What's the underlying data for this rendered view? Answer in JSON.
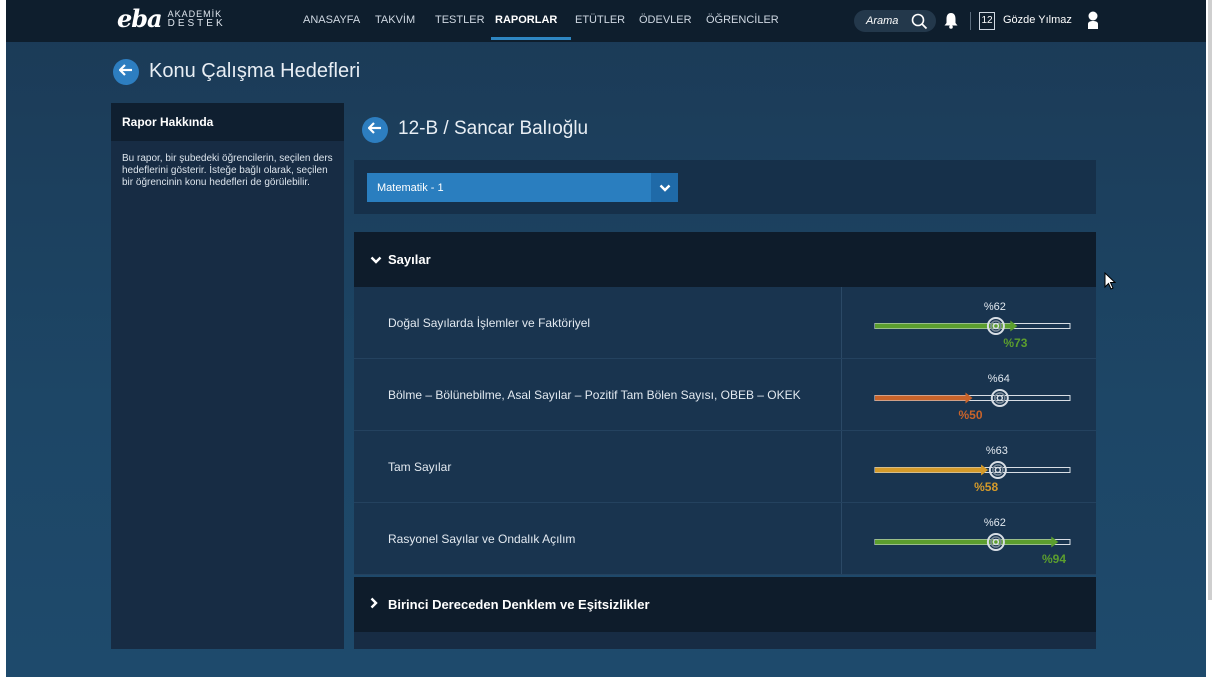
{
  "brand": {
    "logo": "eba",
    "line1": "AKADEMİK",
    "line2": "DESTEK"
  },
  "nav": {
    "items": [
      {
        "label": "ANASAYFA"
      },
      {
        "label": "TAKVİM"
      },
      {
        "label": "TESTLER"
      },
      {
        "label": "RAPORLAR",
        "active": true
      },
      {
        "label": "ETÜTLER"
      },
      {
        "label": "ÖDEVLER"
      },
      {
        "label": "ÖĞRENCİLER"
      }
    ]
  },
  "search": {
    "placeholder": "Arama"
  },
  "messages": {
    "count": "12"
  },
  "user": {
    "name": "Gözde Yılmaz"
  },
  "page": {
    "title": "Konu Çalışma Hedefleri"
  },
  "sidebar": {
    "heading": "Rapor Hakkında",
    "text": "Bu rapor, bir şubedeki öğrencilerin, seçilen ders hedeflerini gösterir. İsteğe bağlı olarak, seçilen bir öğrencinin konu hedefleri de görülebilir."
  },
  "main": {
    "subtitle": "12-B / Sancar Balıoğlu",
    "select": {
      "value": "Matematik - 1"
    },
    "sections": [
      {
        "title": "Sayılar",
        "expanded": true,
        "topics": [
          {
            "name": "Doğal Sayılarda İşlemler ve Faktöriyel",
            "target_label": "%62",
            "target": 62,
            "actual_label": "%73",
            "actual": 73,
            "color": "#5c9e2e"
          },
          {
            "name": "Bölme – Bölünebilme, Asal Sayılar – Pozitif Tam Bölen Sayısı, OBEB – OKEK",
            "target_label": "%64",
            "target": 64,
            "actual_label": "%50",
            "actual": 50,
            "color": "#c8632a"
          },
          {
            "name": "Tam Sayılar",
            "target_label": "%63",
            "target": 63,
            "actual_label": "%58",
            "actual": 58,
            "color": "#d49a2a"
          },
          {
            "name": "Rasyonel Sayılar ve Ondalık Açılım",
            "target_label": "%62",
            "target": 62,
            "actual_label": "%94",
            "actual": 94,
            "color": "#5c9e2e"
          }
        ]
      },
      {
        "title": "Birinci Dereceden Denklem ve Eşitsizlikler",
        "expanded": false
      }
    ]
  },
  "colors": {
    "accent": "#2d7ec0",
    "nav_bg": "#0e1e2d",
    "positive": "#5c9e2e",
    "negative": "#c8632a",
    "warning": "#d49a2a"
  }
}
